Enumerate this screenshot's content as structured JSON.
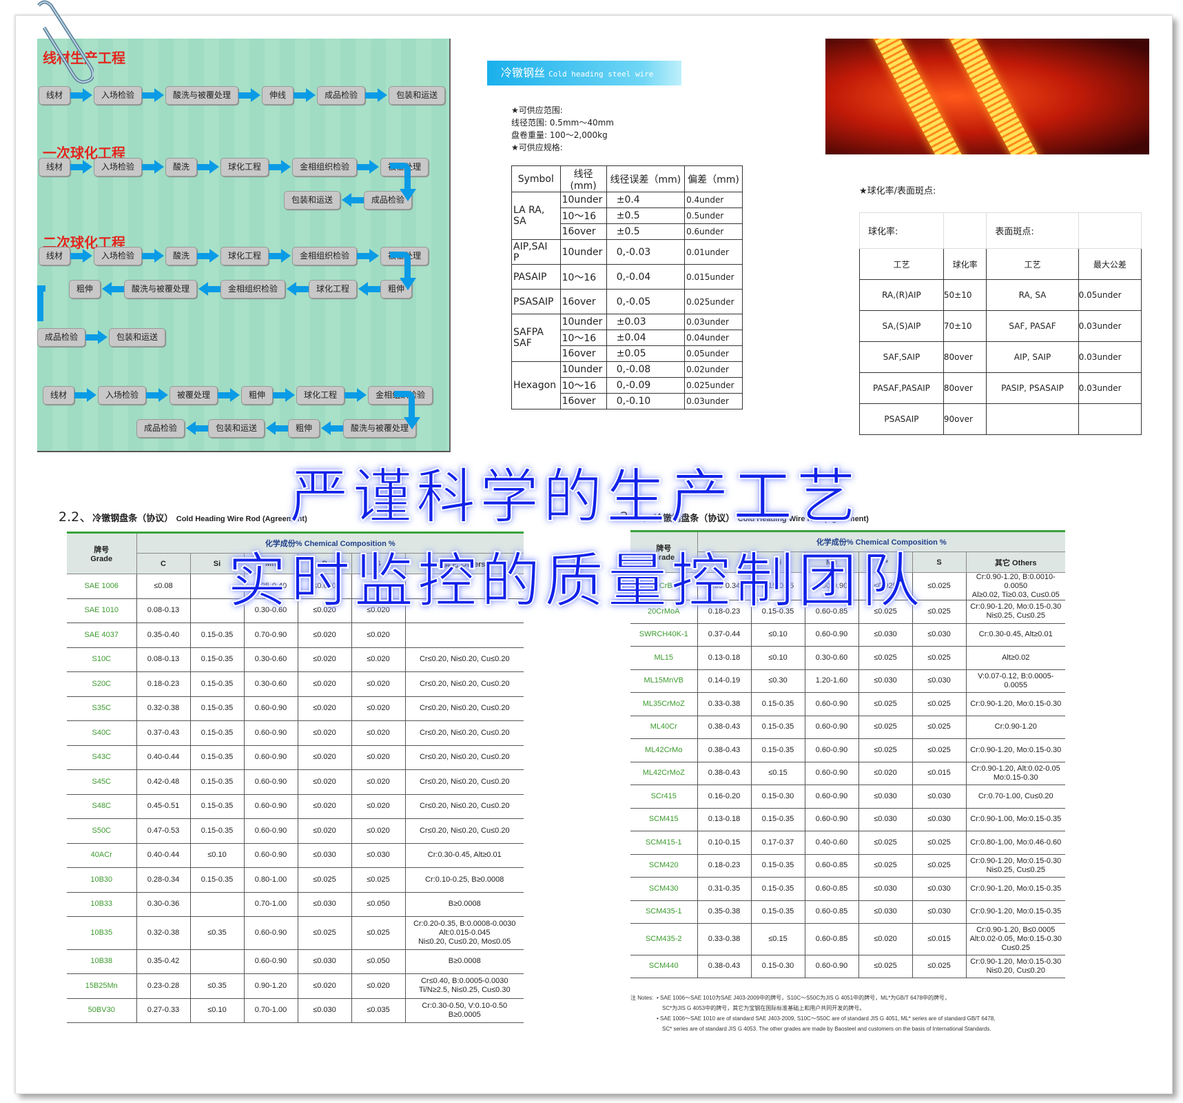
{
  "flow": {
    "titles": [
      "线材生产工程",
      "一次球化工程",
      "二次球化工程"
    ],
    "rows": [
      {
        "id": "r1",
        "dir": "fwd",
        "items": [
          "线材",
          "入场检验",
          "酸洗与被覆处理",
          "伸线",
          "成品检验",
          "包装和运送"
        ]
      },
      {
        "id": "r2",
        "dir": "fwd",
        "items": [
          "线材",
          "入场检验",
          "酸洗",
          "球化工程",
          "金相组织检验",
          "被覆处理"
        ]
      },
      {
        "id": "r3",
        "dir": "rev",
        "items": [
          "成品检验",
          "包装和运送"
        ]
      },
      {
        "id": "r4",
        "dir": "fwd",
        "items": [
          "线材",
          "入场检验",
          "酸洗",
          "球化工程",
          "金相组织检验",
          "被覆处理"
        ]
      },
      {
        "id": "r5",
        "dir": "rev",
        "items": [
          "粗伸",
          "球化工程",
          "金相组织检验",
          "酸洗与被覆处理",
          "粗伸"
        ]
      },
      {
        "id": "r6",
        "dir": "fwd",
        "items": [
          "成品检验",
          "包装和运送"
        ]
      },
      {
        "id": "r7",
        "dir": "fwd",
        "items": [
          "线材",
          "入场检验",
          "被覆处理",
          "粗伸",
          "球化工程",
          "金相组织检验"
        ]
      },
      {
        "id": "r8",
        "dir": "rev",
        "items": [
          "酸洗与被覆处理",
          "粗伸",
          "包装和运送",
          "成品检验"
        ]
      }
    ]
  },
  "banner": {
    "cn": "冷镦钢丝",
    "en": "Cold heading steel wire"
  },
  "supply": {
    "lines": [
      "★可供应范围:",
      "线径范围: 0.5mm～40mm",
      "盘卷重量: 100～2,000kg",
      "★可供应规格:"
    ]
  },
  "spec_table": {
    "header": [
      "Symbol",
      "线径\n(mm)",
      "线径误差（mm)",
      "偏差（mm)"
    ],
    "groups": [
      {
        "symbol": "LA RA,\nSA",
        "rows": [
          [
            "10under",
            "±0.4",
            "0.4under"
          ],
          [
            "10～16",
            "±0.5",
            "0.5under"
          ],
          [
            "16over",
            "±0.5",
            "0.6under"
          ]
        ]
      },
      {
        "symbol": "AIP,SAI\nP",
        "rows": [
          [
            "10under",
            "0,-0.03",
            "0.01under"
          ]
        ]
      },
      {
        "symbol": "PASAIP",
        "rows": [
          [
            "10～16",
            "0,-0.04",
            "0.015under"
          ]
        ]
      },
      {
        "symbol": "PSASAIP",
        "rows": [
          [
            "16over",
            "0,-0.05",
            "0.025under"
          ]
        ]
      },
      {
        "symbol": "SAFPA\nSAF",
        "rows": [
          [
            "10under",
            "±0.03",
            "0.03under"
          ],
          [
            "10～16",
            "±0.04",
            "0.04under"
          ],
          [
            "16over",
            "±0.05",
            "0.05under"
          ]
        ]
      },
      {
        "symbol": "Hexagon",
        "rows": [
          [
            "10under",
            "0,-0.08",
            "0.02under"
          ],
          [
            "10～16",
            "0,-0.09",
            "0.025under"
          ],
          [
            "16over",
            "0,-0.10",
            "0.03under"
          ]
        ]
      }
    ]
  },
  "spheroid": {
    "label": "★球化率/表面斑点:",
    "top": [
      "球化率:",
      "",
      "表面斑点:",
      ""
    ],
    "header": [
      "工艺",
      "球化率",
      "工艺",
      "最大公差"
    ],
    "rows": [
      [
        "RA,(R)AIP",
        "50±10",
        "RA, SA",
        "0.05under"
      ],
      [
        "SA,(S)AIP",
        "70±10",
        "SAF, PASAF",
        "0.03under"
      ],
      [
        "SAF,SAIP",
        "80over",
        "AIP, SAIP",
        "0.03under"
      ],
      [
        "PASAF,PASAIP",
        "80over",
        "PASIP, PSASAIP",
        "0.03under"
      ],
      [
        "PSASAIP",
        "90over",
        "",
        ""
      ]
    ]
  },
  "heading": {
    "num": "2.2、",
    "cn": "冷镦钢盘条（协议）",
    "en": "Cold Heading Wire Rod (Agreement)"
  },
  "chem_header": {
    "grade": "牌号\nGrade",
    "comp": "化学成份%  Chemical Composition %",
    "cols": [
      "C",
      "Si",
      "Mn",
      "P",
      "S",
      "其它 Others"
    ]
  },
  "chem_left": [
    [
      "SAE 1006",
      "≤0.08",
      "",
      "0.25-0.40",
      "≤0.040",
      "≤0.050",
      ""
    ],
    [
      "SAE 1010",
      "0.08-0.13",
      "",
      "0.30-0.60",
      "≤0.020",
      "≤0.020",
      ""
    ],
    [
      "SAE 4037",
      "0.35-0.40",
      "0.15-0.35",
      "0.70-0.90",
      "≤0.020",
      "≤0.020",
      ""
    ],
    [
      "S10C",
      "0.08-0.13",
      "0.15-0.35",
      "0.30-0.60",
      "≤0.020",
      "≤0.020",
      "Cr≤0.20, Ni≤0.20, Cu≤0.20"
    ],
    [
      "S20C",
      "0.18-0.23",
      "0.15-0.35",
      "0.30-0.60",
      "≤0.020",
      "≤0.020",
      "Cr≤0.20, Ni≤0.20, Cu≤0.20"
    ],
    [
      "S35C",
      "0.32-0.38",
      "0.15-0.35",
      "0.60-0.90",
      "≤0.020",
      "≤0.020",
      "Cr≤0.20, Ni≤0.20, Cu≤0.20"
    ],
    [
      "S40C",
      "0.37-0.43",
      "0.15-0.35",
      "0.60-0.90",
      "≤0.020",
      "≤0.020",
      "Cr≤0.20, Ni≤0.20, Cu≤0.20"
    ],
    [
      "S43C",
      "0.40-0.44",
      "0.15-0.35",
      "0.60-0.90",
      "≤0.020",
      "≤0.020",
      "Cr≤0.20, Ni≤0.20, Cu≤0.20"
    ],
    [
      "S45C",
      "0.42-0.48",
      "0.15-0.35",
      "0.60-0.90",
      "≤0.020",
      "≤0.020",
      "Cr≤0.20, Ni≤0.20, Cu≤0.20"
    ],
    [
      "S48C",
      "0.45-0.51",
      "0.15-0.35",
      "0.60-0.90",
      "≤0.020",
      "≤0.020",
      "Cr≤0.20, Ni≤0.20, Cu≤0.20"
    ],
    [
      "S50C",
      "0.47-0.53",
      "0.15-0.35",
      "0.60-0.90",
      "≤0.020",
      "≤0.020",
      "Cr≤0.20, Ni≤0.20, Cu≤0.20"
    ],
    [
      "40ACr",
      "0.40-0.44",
      "≤0.10",
      "0.60-0.90",
      "≤0.030",
      "≤0.030",
      "Cr:0.30-0.45, Alt≥0.01"
    ],
    [
      "10B30",
      "0.28-0.34",
      "0.15-0.35",
      "0.80-1.00",
      "≤0.025",
      "≤0.025",
      "Cr:0.10-0.25, B≥0.0008"
    ],
    [
      "10B33",
      "0.30-0.36",
      "",
      "0.70-1.00",
      "≤0.030",
      "≤0.050",
      "B≥0.0008"
    ],
    [
      "10B35",
      "0.32-0.38",
      "≤0.35",
      "0.60-0.90",
      "≤0.025",
      "≤0.025",
      "Cr:0.20-0.35, B:0.0008-0.0030\nAlt:0.015-0.045\nNi≤0.20, Cu≤0.20, Mo≤0.05"
    ],
    [
      "10B38",
      "0.35-0.42",
      "",
      "0.60-0.90",
      "≤0.030",
      "≤0.050",
      "B≥0.0008"
    ],
    [
      "15B25Mn",
      "0.23-0.28",
      "≤0.35",
      "0.90-1.20",
      "≤0.020",
      "≤0.020",
      "Cr≤0.40, B:0.0005-0.0030\nTi/N≥2.5, Ni≤0.25, Cu≤0.30"
    ],
    [
      "50BV30",
      "0.27-0.33",
      "≤0.10",
      "0.70-1.00",
      "≤0.030",
      "≤0.035",
      "Cr:0.30-0.50, V:0.10-0.50\nB≥0.0005"
    ]
  ],
  "chem_right": [
    [
      "32CrB4",
      "0.30-0.34",
      "0.15-0.35",
      "0.60-0.90",
      "≤0.025",
      "≤0.025",
      "Cr:0.90-1.20, B:0.0010-0.0050\nAl≥0.02, Ti≥0.03, Cu≤0.05"
    ],
    [
      "20CrMoA",
      "0.18-0.23",
      "0.15-0.35",
      "0.60-0.85",
      "≤0.025",
      "≤0.025",
      "Cr:0.90-1.20, Mo:0.15-0.30\nNi≤0.25, Cu≤0.25"
    ],
    [
      "SWRCH40K-1",
      "0.37-0.44",
      "≤0.10",
      "0.60-0.90",
      "≤0.030",
      "≤0.030",
      "Cr:0.30-0.45, Alt≥0.01"
    ],
    [
      "ML15",
      "0.13-0.18",
      "≤0.10",
      "0.30-0.60",
      "≤0.025",
      "≤0.025",
      "Alt≥0.02"
    ],
    [
      "ML15MnVB",
      "0.14-0.19",
      "≤0.30",
      "1.20-1.60",
      "≤0.030",
      "≤0.030",
      "V:0.07-0.12, B:0.0005-0.0055"
    ],
    [
      "ML35CrMoZ",
      "0.33-0.38",
      "0.15-0.35",
      "0.60-0.90",
      "≤0.025",
      "≤0.025",
      "Cr:0.90-1.20, Mo:0.15-0.30"
    ],
    [
      "ML40Cr",
      "0.38-0.43",
      "0.15-0.35",
      "0.60-0.90",
      "≤0.025",
      "≤0.025",
      "Cr:0.90-1.20"
    ],
    [
      "ML42CrMo",
      "0.38-0.43",
      "0.15-0.35",
      "0.60-0.90",
      "≤0.025",
      "≤0.025",
      "Cr:0.90-1.20, Mo:0.15-0.30"
    ],
    [
      "ML42CrMoZ",
      "0.38-0.43",
      "≤0.15",
      "0.60-0.90",
      "≤0.020",
      "≤0.015",
      "Cr:0.90-1.20, Alt:0.02-0.05\nMo:0.15-0.30"
    ],
    [
      "SCr415",
      "0.16-0.20",
      "0.15-0.30",
      "0.60-0.90",
      "≤0.030",
      "≤0.030",
      "Cr:0.70-1.00, Cu≤0.20"
    ],
    [
      "SCM415",
      "0.13-0.18",
      "0.15-0.35",
      "0.60-0.90",
      "≤0.030",
      "≤0.030",
      "Cr:0.90-1.00, Mo:0.15-0.35"
    ],
    [
      "SCM415-1",
      "0.10-0.15",
      "0.17-0.37",
      "0.40-0.60",
      "≤0.025",
      "≤0.025",
      "Cr:0.80-1.00, Mo:0.46-0.60"
    ],
    [
      "SCM420",
      "0.18-0.23",
      "0.15-0.35",
      "0.60-0.85",
      "≤0.025",
      "≤0.025",
      "Cr:0.90-1.20, Mo:0.15-0.30\nNi≤0.25, Cu≤0.25"
    ],
    [
      "SCM430",
      "0.31-0.35",
      "0.15-0.35",
      "0.60-0.85",
      "≤0.030",
      "≤0.030",
      "Cr:0.90-1.20, Mo:0.15-0.35"
    ],
    [
      "SCM435-1",
      "0.35-0.38",
      "0.15-0.35",
      "0.60-0.85",
      "≤0.030",
      "≤0.030",
      "Cr:0.90-1.20, Mo:0.15-0.35"
    ],
    [
      "SCM435-2",
      "0.33-0.38",
      "≤0.15",
      "0.60-0.85",
      "≤0.020",
      "≤0.015",
      "Cr:0.90-1.20, B≤0.0005\nAlt:0.02-0.05, Mo:0.15-0.30\nCu≤0.25"
    ],
    [
      "SCM440",
      "0.38-0.43",
      "0.15-0.30",
      "0.60-0.90",
      "≤0.025",
      "≤0.025",
      "Cr:0.90-1.20, Mo:0.15-0.30\nNi≤0.20, Cu≤0.20"
    ]
  ],
  "notes": {
    "label": "注 Notes:",
    "lines": [
      "• SAE 1006～SAE 1010为SAE J403-2009中的牌号，S10C～S50C为JIS G 4051中的牌号，ML*为GB/T 6478中的牌号，",
      "SC*为JIS G 4053中的牌号，其它为宝钢在国际标准基础上和用户共同开发的牌号。",
      "• SAE 1006～SAE 1010 are of standard SAE J403-2009, S10C～S50C are of standard JIS G 4051, ML* series are of standard GB/T 6478,",
      "SC* series are of standard JIS G 4053. The other grades are made by Baosteel and customers on the basis of International Standards."
    ]
  },
  "overlay": {
    "line1": "严谨科学的生产工艺",
    "line2": "实时监控的质量控制团队"
  },
  "colors": {
    "flow_arrow": "#0a9be6",
    "title_red": "#e3261f",
    "grade_green": "#3c9a2e",
    "overlay_blue": "#1222e8",
    "panel_green": "#a3dec5"
  }
}
